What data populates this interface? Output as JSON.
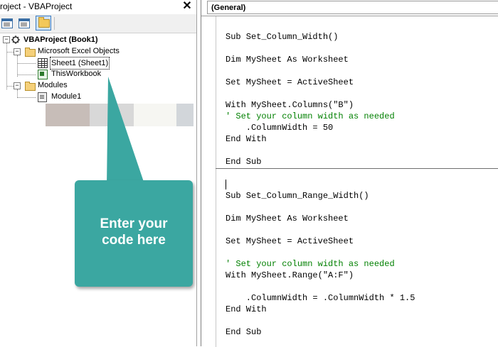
{
  "project_explorer": {
    "title": "roject - VBAProject",
    "close_glyph": "✕",
    "toolbar": {
      "buttons": [
        {
          "name": "view-code-button",
          "icon": "window-icon"
        },
        {
          "name": "view-object-button",
          "icon": "window-icon"
        },
        {
          "name": "toggle-folders-button",
          "icon": "folder-icon"
        }
      ]
    },
    "tree": {
      "project": "VBAProject (Book1)",
      "excel_objects_folder": "Microsoft Excel Objects",
      "sheet1": "Sheet1 (Sheet1)",
      "thisworkbook": "ThisWorkbook",
      "modules_folder": "Modules",
      "module1": "Module1",
      "expanded_glyph": "−"
    }
  },
  "callout": {
    "line1": "Enter your",
    "line2": "code here",
    "color": "#3ba7a1"
  },
  "code_window": {
    "object_dropdown": "(General)",
    "procedure1": [
      {
        "text": "Sub Set_Column_Width()",
        "type": "code"
      },
      {
        "text": "Dim MySheet As Worksheet",
        "type": "code"
      },
      {
        "text": "Set MySheet = ActiveSheet",
        "type": "code"
      },
      {
        "text": "With MySheet.Columns(\"B\")",
        "type": "code"
      },
      {
        "text": "' Set your column width as needed",
        "type": "comment"
      },
      {
        "text": "    .ColumnWidth = 50",
        "type": "code"
      },
      {
        "text": "End With",
        "type": "code"
      },
      {
        "text": "End Sub",
        "type": "code"
      }
    ],
    "procedure2": [
      {
        "text": "Sub Set_Column_Range_Width()",
        "type": "code"
      },
      {
        "text": "Dim MySheet As Worksheet",
        "type": "code"
      },
      {
        "text": "Set MySheet = ActiveSheet",
        "type": "code"
      },
      {
        "text": "' Set your column width as needed",
        "type": "comment"
      },
      {
        "text": "With MySheet.Range(\"A:F\")",
        "type": "code"
      },
      {
        "text": "    .ColumnWidth = .ColumnWidth * 1.5",
        "type": "code"
      },
      {
        "text": "End With",
        "type": "code"
      },
      {
        "text": "End Sub",
        "type": "code"
      }
    ],
    "comment_color": "#008000"
  }
}
